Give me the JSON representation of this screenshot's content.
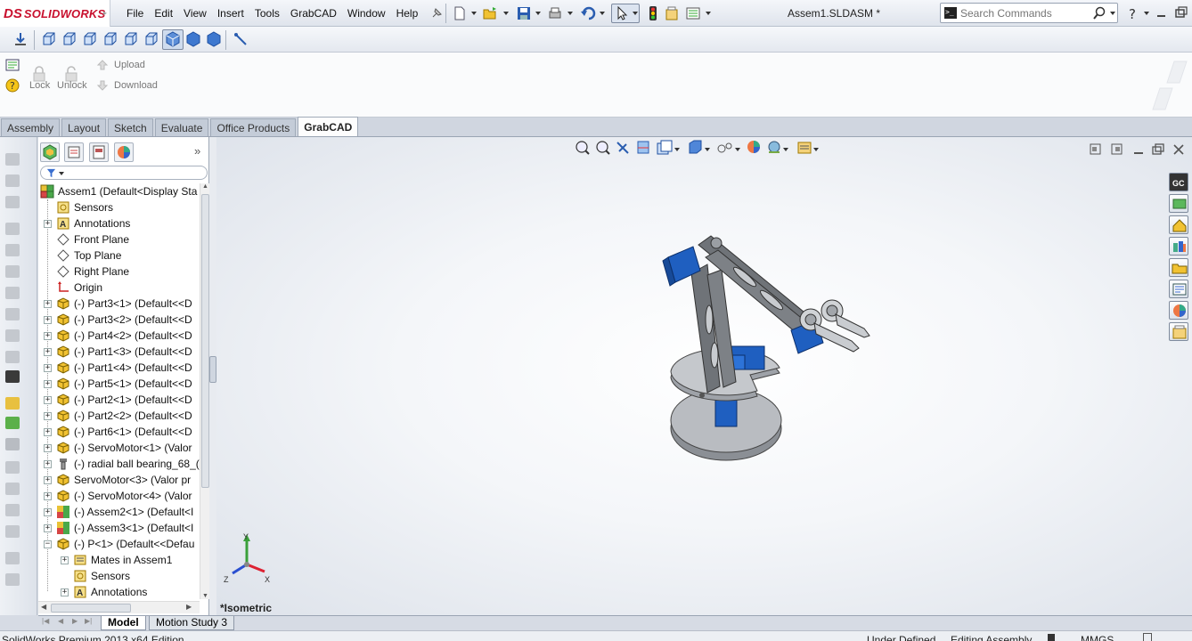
{
  "app": {
    "brand_mark": "DS",
    "brand_name": "SOLIDWORKS"
  },
  "menu": [
    "File",
    "Edit",
    "View",
    "Insert",
    "Tools",
    "GrabCAD",
    "Window",
    "Help"
  ],
  "document_title": "Assem1.SLDASM *",
  "search": {
    "placeholder": "Search Commands"
  },
  "command_area": {
    "lock": "Lock",
    "unlock": "Unlock",
    "upload": "Upload",
    "download": "Download"
  },
  "tabs": [
    {
      "label": "Assembly",
      "active": false
    },
    {
      "label": "Layout",
      "active": false
    },
    {
      "label": "Sketch",
      "active": false
    },
    {
      "label": "Evaluate",
      "active": false
    },
    {
      "label": "Office Products",
      "active": false
    },
    {
      "label": "GrabCAD",
      "active": true
    }
  ],
  "feature_tree": {
    "root": "Assem1  (Default<Display Sta",
    "items": [
      {
        "label": "Sensors",
        "icon": "sensor-icon",
        "level": 1,
        "expandable": false
      },
      {
        "label": "Annotations",
        "icon": "annotation-icon",
        "level": 1,
        "expandable": true
      },
      {
        "label": "Front Plane",
        "icon": "plane-icon",
        "level": 1,
        "expandable": false
      },
      {
        "label": "Top Plane",
        "icon": "plane-icon",
        "level": 1,
        "expandable": false
      },
      {
        "label": "Right Plane",
        "icon": "plane-icon",
        "level": 1,
        "expandable": false
      },
      {
        "label": "Origin",
        "icon": "origin-icon",
        "level": 1,
        "expandable": false
      },
      {
        "label": "(-) Part3<1>  (Default<<D",
        "icon": "part-icon",
        "level": 1,
        "expandable": true
      },
      {
        "label": "(-) Part3<2>  (Default<<D",
        "icon": "part-icon",
        "level": 1,
        "expandable": true
      },
      {
        "label": "(-) Part4<2>  (Default<<D",
        "icon": "part-icon",
        "level": 1,
        "expandable": true
      },
      {
        "label": "(-) Part1<3>  (Default<<D",
        "icon": "part-icon",
        "level": 1,
        "expandable": true
      },
      {
        "label": "(-) Part1<4>  (Default<<D",
        "icon": "part-icon",
        "level": 1,
        "expandable": true
      },
      {
        "label": "(-) Part5<1>  (Default<<D",
        "icon": "part-icon",
        "level": 1,
        "expandable": true
      },
      {
        "label": "(-) Part2<1>  (Default<<D",
        "icon": "part-icon",
        "level": 1,
        "expandable": true
      },
      {
        "label": "(-) Part2<2>  (Default<<D",
        "icon": "part-icon",
        "level": 1,
        "expandable": true
      },
      {
        "label": "(-) Part6<1>  (Default<<D",
        "icon": "part-icon",
        "level": 1,
        "expandable": true
      },
      {
        "label": "(-) ServoMotor<1>  (Valor",
        "icon": "part-icon",
        "level": 1,
        "expandable": true
      },
      {
        "label": "(-) radial ball bearing_68_(",
        "icon": "bearing-icon",
        "level": 1,
        "expandable": true
      },
      {
        "label": "ServoMotor<3>  (Valor pr",
        "icon": "part-icon",
        "level": 1,
        "expandable": true
      },
      {
        "label": "(-) ServoMotor<4>  (Valor",
        "icon": "part-icon",
        "level": 1,
        "expandable": true
      },
      {
        "label": "(-) Assem2<1>  (Default<I",
        "icon": "subassembly-icon",
        "level": 1,
        "expandable": true
      },
      {
        "label": "(-) Assem3<1>  (Default<I",
        "icon": "subassembly-icon",
        "level": 1,
        "expandable": true
      },
      {
        "label": "(-) P<1>  (Default<<Defau",
        "icon": "part-icon",
        "level": 1,
        "expandable": true,
        "expanded": true
      },
      {
        "label": "Mates in Assem1",
        "icon": "mates-icon",
        "level": 2,
        "expandable": true
      },
      {
        "label": "Sensors",
        "icon": "sensor-icon",
        "level": 2,
        "expandable": false
      },
      {
        "label": "Annotations",
        "icon": "annotation-icon",
        "level": 2,
        "expandable": true
      }
    ]
  },
  "graphics": {
    "view_name": "*Isometric",
    "triad": {
      "x": "X",
      "y": "Y",
      "z": "Z"
    }
  },
  "bottom_tabs": [
    {
      "label": "Model",
      "active": true
    },
    {
      "label": "Motion Study 3",
      "active": false
    }
  ],
  "status": {
    "left": "SolidWorks Premium 2013 x64 Edition",
    "definition": "Under Defined",
    "mode": "Editing Assembly",
    "units": "MMGS"
  },
  "colors": {
    "brand": "#c8102e",
    "servo_blue": "#1f5fc0",
    "arm_gray": "#6f7378",
    "base_gray": "#a7abb1"
  }
}
